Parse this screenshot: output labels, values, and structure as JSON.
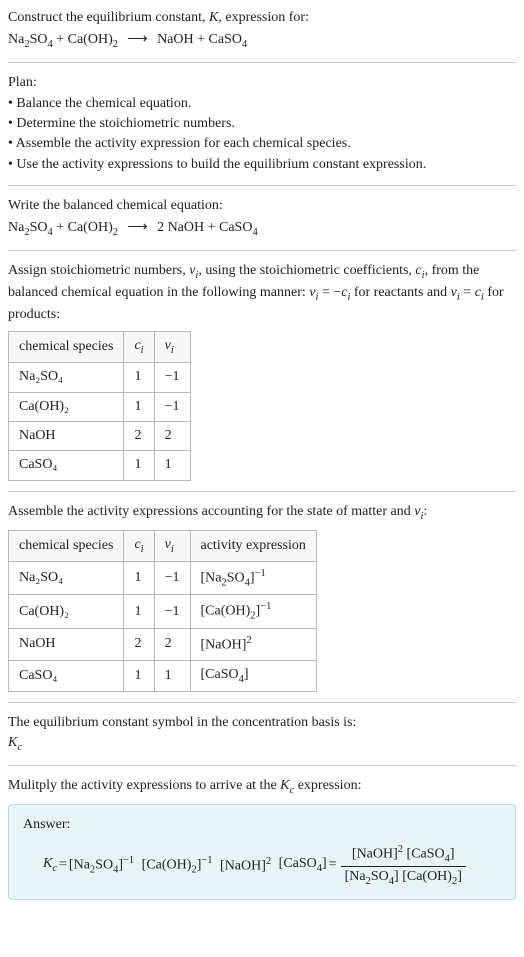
{
  "intro": {
    "line1": "Construct the equilibrium constant, ",
    "k": "K",
    "line1b": ", expression for:",
    "eq_lhs1": "Na",
    "eq_lhs2": "SO",
    "eq_plus": " + Ca(OH)",
    "eq_arrow": "⟶",
    "eq_rhs1": "NaOH + CaSO"
  },
  "plan": {
    "title": "Plan:",
    "b1": "• Balance the chemical equation.",
    "b2": "• Determine the stoichiometric numbers.",
    "b3": "• Assemble the activity expression for each chemical species.",
    "b4": "• Use the activity expressions to build the equilibrium constant expression."
  },
  "balanced": {
    "title": "Write the balanced chemical equation:",
    "lhs1": "Na",
    "lhs2": "SO",
    "plus": " + Ca(OH)",
    "arrow": "⟶",
    "rhs": "2 NaOH + CaSO"
  },
  "assign": {
    "p1": "Assign stoichiometric numbers, ",
    "nu": "ν",
    "p2": ", using the stoichiometric coefficients, ",
    "c": "c",
    "p3": ", from the balanced chemical equation in the following manner: ",
    "eq1": " = −",
    "p4": " for reactants and ",
    "eq2": " = ",
    "p5": " for products:"
  },
  "table1": {
    "h1": "chemical species",
    "h2": "c",
    "h3": "ν",
    "r1": {
      "sp": "Na₂SO₄",
      "c": "1",
      "v": "−1"
    },
    "r2": {
      "sp": "Ca(OH)₂",
      "c": "1",
      "v": "−1"
    },
    "r3": {
      "sp": "NaOH",
      "c": "2",
      "v": "2"
    },
    "r4": {
      "sp": "CaSO₄",
      "c": "1",
      "v": "1"
    }
  },
  "assemble": {
    "p1": "Assemble the activity expressions accounting for the state of matter and ",
    "nu": "ν",
    "p2": ":"
  },
  "table2": {
    "h1": "chemical species",
    "h2": "c",
    "h3": "ν",
    "h4": "activity expression",
    "r1": {
      "sp": "Na₂SO₄",
      "c": "1",
      "v": "−1",
      "a1": "[Na",
      "a2": "SO",
      "a3": "]",
      "exp": "−1"
    },
    "r2": {
      "sp": "Ca(OH)₂",
      "c": "1",
      "v": "−1",
      "a1": "[Ca(OH)",
      "a2": "]",
      "exp": "−1"
    },
    "r3": {
      "sp": "NaOH",
      "c": "2",
      "v": "2",
      "a1": "[NaOH]",
      "exp": "2"
    },
    "r4": {
      "sp": "CaSO₄",
      "c": "1",
      "v": "1",
      "a1": "[CaSO",
      "a2": "]"
    }
  },
  "symbol": {
    "p": "The equilibrium constant symbol in the concentration basis is:",
    "k": "K",
    "c": "c"
  },
  "mult": {
    "p1": "Mulitply the activity expressions to arrive at the ",
    "k": "K",
    "c": "c",
    "p2": " expression:"
  },
  "answer": {
    "label": "Answer:",
    "k": "K",
    "c": "c",
    "eq": " = ",
    "t1a": "[Na",
    "t1b": "SO",
    "t1c": "]",
    "t2a": "[Ca(OH)",
    "t2b": "]",
    "t3": "[NaOH]",
    "t4a": "[CaSO",
    "t4b": "]",
    "exp_m1": "−1",
    "exp_2": "2",
    "eq2": " = ",
    "num1": "[NaOH]",
    "num2a": "[CaSO",
    "num2b": "]",
    "den1a": "[Na",
    "den1b": "SO",
    "den1c": "]",
    "den2a": "[Ca(OH)",
    "den2b": "]"
  },
  "subs": {
    "two": "2",
    "four": "4",
    "i": "i"
  }
}
